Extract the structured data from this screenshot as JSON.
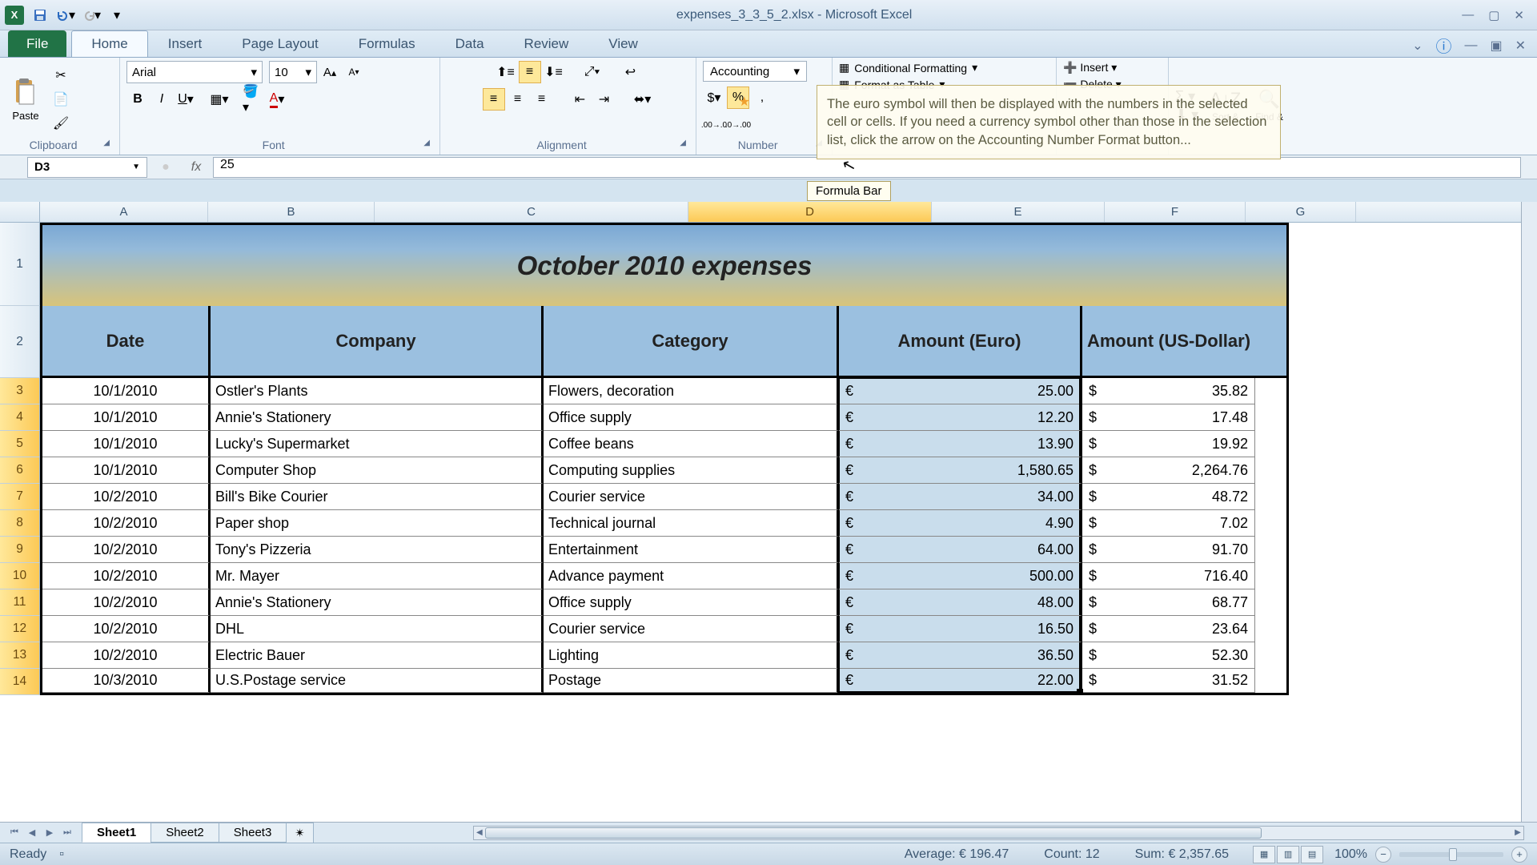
{
  "app": {
    "filename": "expenses_3_3_5_2.xlsx",
    "appname": "Microsoft Excel"
  },
  "tabs": {
    "file": "File",
    "home": "Home",
    "insert": "Insert",
    "pagelayout": "Page Layout",
    "formulas": "Formulas",
    "data": "Data",
    "review": "Review",
    "view": "View"
  },
  "ribbon": {
    "clipboard": {
      "label": "Clipboard",
      "paste": "Paste"
    },
    "font": {
      "label": "Font",
      "name": "Arial",
      "size": "10"
    },
    "alignment": {
      "label": "Alignment"
    },
    "number": {
      "label": "Number",
      "format": "Accounting"
    },
    "styles": {
      "conditional": "Conditional Formatting",
      "table": "Format as Table"
    },
    "cells": {
      "insert": "Insert",
      "delete": "Delete"
    },
    "editing": {
      "sort": "Sort &",
      "find": "Find &"
    }
  },
  "tooltip": {
    "text": "The euro symbol will then be displayed with the numbers in the selected cell or cells. If you need a currency symbol other than those in the selection list, click the arrow on the Accounting Number Format button...",
    "formula_bar": "Formula Bar"
  },
  "namebox": "D3",
  "formula_value": "25",
  "columns": [
    "A",
    "B",
    "C",
    "D",
    "E",
    "F",
    "G"
  ],
  "sheet": {
    "title": "October 2010 expenses",
    "headers": [
      "Date",
      "Company",
      "Category",
      "Amount (Euro)",
      "Amount (US-Dollar)"
    ],
    "rows": [
      {
        "n": 3,
        "date": "10/1/2010",
        "company": "Ostler's Plants",
        "category": "Flowers, decoration",
        "euro": "25.00",
        "usd": "35.82"
      },
      {
        "n": 4,
        "date": "10/1/2010",
        "company": "Annie's Stationery",
        "category": "Office supply",
        "euro": "12.20",
        "usd": "17.48"
      },
      {
        "n": 5,
        "date": "10/1/2010",
        "company": "Lucky's Supermarket",
        "category": "Coffee beans",
        "euro": "13.90",
        "usd": "19.92"
      },
      {
        "n": 6,
        "date": "10/1/2010",
        "company": "Computer Shop",
        "category": "Computing supplies",
        "euro": "1,580.65",
        "usd": "2,264.76"
      },
      {
        "n": 7,
        "date": "10/2/2010",
        "company": "Bill's Bike Courier",
        "category": "Courier service",
        "euro": "34.00",
        "usd": "48.72"
      },
      {
        "n": 8,
        "date": "10/2/2010",
        "company": "Paper shop",
        "category": "Technical journal",
        "euro": "4.90",
        "usd": "7.02"
      },
      {
        "n": 9,
        "date": "10/2/2010",
        "company": "Tony's Pizzeria",
        "category": "Entertainment",
        "euro": "64.00",
        "usd": "91.70"
      },
      {
        "n": 10,
        "date": "10/2/2010",
        "company": "Mr. Mayer",
        "category": "Advance payment",
        "euro": "500.00",
        "usd": "716.40"
      },
      {
        "n": 11,
        "date": "10/2/2010",
        "company": "Annie's Stationery",
        "category": "Office supply",
        "euro": "48.00",
        "usd": "68.77"
      },
      {
        "n": 12,
        "date": "10/2/2010",
        "company": "DHL",
        "category": "Courier service",
        "euro": "16.50",
        "usd": "23.64"
      },
      {
        "n": 13,
        "date": "10/2/2010",
        "company": "Electric Bauer",
        "category": "Lighting",
        "euro": "36.50",
        "usd": "52.30"
      },
      {
        "n": 14,
        "date": "10/3/2010",
        "company": "U.S.Postage service",
        "category": "Postage",
        "euro": "22.00",
        "usd": "31.52"
      }
    ]
  },
  "sheets": [
    "Sheet1",
    "Sheet2",
    "Sheet3"
  ],
  "status": {
    "ready": "Ready",
    "average": "Average:  € 196.47",
    "count": "Count: 12",
    "sum": "Sum:  € 2,357.65",
    "zoom": "100%"
  }
}
